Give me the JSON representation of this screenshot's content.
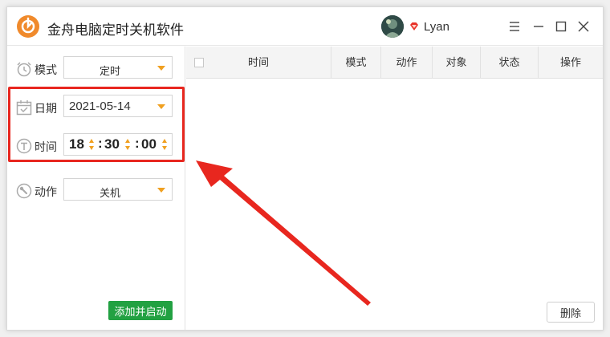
{
  "app": {
    "title": "金舟电脑定时关机软件"
  },
  "user": {
    "name": "Lyan"
  },
  "form": {
    "mode": {
      "label": "模式",
      "value": "定时",
      "icon": "alarm-clock-icon"
    },
    "date": {
      "label": "日期",
      "value": "2021-05-14",
      "icon": "calendar-icon"
    },
    "time": {
      "label": "时间",
      "hour": "18",
      "minute": "30",
      "second": "00",
      "icon": "clock-t-icon"
    },
    "action": {
      "label": "动作",
      "value": "关机",
      "icon": "wrench-icon"
    },
    "submit_label": "添加并启动"
  },
  "table": {
    "columns": [
      "时间",
      "模式",
      "动作",
      "对象",
      "状态",
      "操作"
    ],
    "rows": []
  },
  "delete_label": "删除",
  "colors": {
    "accent": "#f0a020",
    "primary": "#22a142",
    "annotation": "#e8271f",
    "logo": "#f08a2c"
  }
}
